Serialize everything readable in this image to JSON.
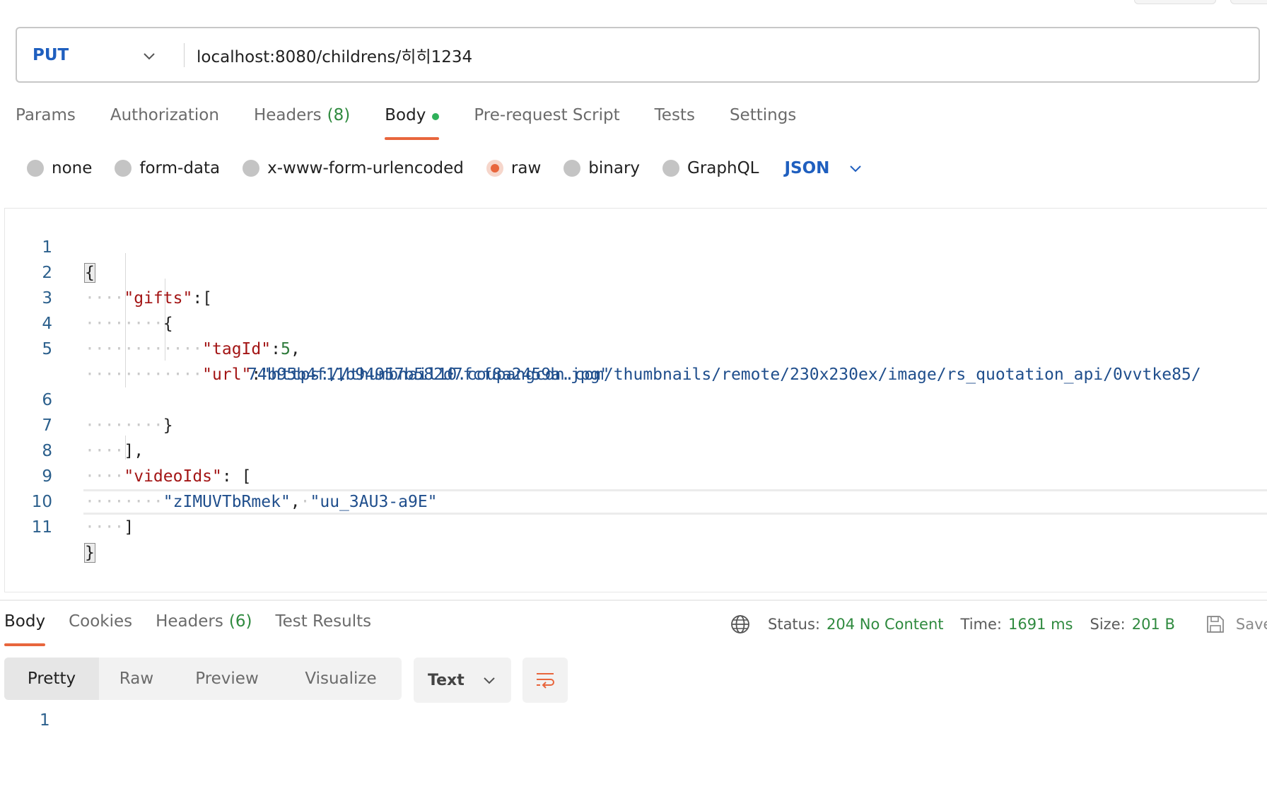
{
  "request": {
    "method": "PUT",
    "url": "localhost:8080/childrens/히히1234"
  },
  "request_tabs": [
    {
      "label": "Params"
    },
    {
      "label": "Authorization"
    },
    {
      "label": "Headers",
      "count": "(8)"
    },
    {
      "label": "Body",
      "active": true
    },
    {
      "label": "Pre-request Script"
    },
    {
      "label": "Tests"
    },
    {
      "label": "Settings"
    }
  ],
  "body_types": {
    "options": [
      "none",
      "form-data",
      "x-www-form-urlencoded",
      "raw",
      "binary",
      "GraphQL"
    ],
    "selected": "raw",
    "language": "JSON"
  },
  "editor": {
    "line_numbers": [
      "1",
      "2",
      "3",
      "4",
      "5",
      "6",
      "7",
      "8",
      "9",
      "10",
      "11"
    ],
    "lines": {
      "l1": "{",
      "l2_key": "\"gifts\"",
      "l2_rest": ":[",
      "l3": "{",
      "l4_key": "\"tagId\"",
      "l4_colon": ":",
      "l4_num": "5",
      "l4_comma": ",",
      "l5_key": "\"url\"",
      "l5_colon": ":",
      "l5_str_a": "\"https://thumbnail10.coupangcdn.com/thumbnails/remote/230x230ex/image/rs_quotation_api/0vvtke85/",
      "l5_str_b": "74b95b4f11b94957b582d7fcf8a2459a.jpg\"",
      "l6": "}",
      "l7": "],",
      "l8_key": "\"videoIds\"",
      "l8_rest": ": [",
      "l9_s1": "\"zIMUVTbRmek\"",
      "l9_comma": ",",
      "l9_s2": "\"uu_3AU3-a9E\"",
      "l10": "]",
      "l11": "}"
    }
  },
  "response": {
    "tabs": [
      {
        "label": "Body",
        "active": true
      },
      {
        "label": "Cookies"
      },
      {
        "label": "Headers",
        "count": "(6)"
      },
      {
        "label": "Test Results"
      }
    ],
    "status_label": "Status:",
    "status_value": "204 No Content",
    "time_label": "Time:",
    "time_value": "1691 ms",
    "size_label": "Size:",
    "size_value": "201 B",
    "save_label": "Save",
    "views": [
      "Pretty",
      "Raw",
      "Preview",
      "Visualize"
    ],
    "format": "Text",
    "line_number": "1"
  },
  "colors": {
    "accent": "#e8663d",
    "method": "#1f5fbf",
    "success": "#2f8a3f"
  }
}
